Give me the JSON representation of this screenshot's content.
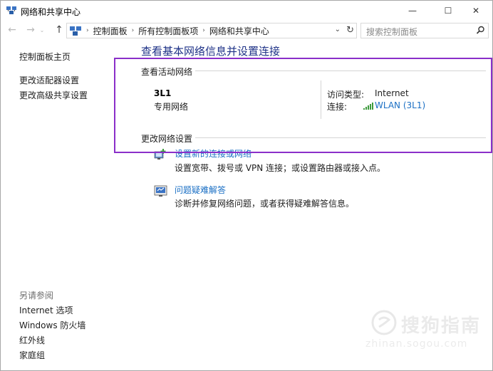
{
  "window": {
    "title": "网络和共享中心",
    "minimize_glyph": "—",
    "maximize_glyph": "☐",
    "close_glyph": "✕"
  },
  "navbar": {
    "back_glyph": "←",
    "forward_glyph": "→",
    "recent_glyph": "⌄",
    "up_glyph": "↑",
    "breadcrumbs": [
      "控制面板",
      "所有控制面板项",
      "网络和共享中心"
    ],
    "breadcrumb_sep": "›",
    "dropdown_glyph": "⌄",
    "refresh_glyph": "↻",
    "search_placeholder": "搜索控制面板"
  },
  "sidebar": {
    "items": [
      {
        "label": "控制面板主页"
      },
      {
        "label": "更改适配器设置"
      },
      {
        "label": "更改高级共享设置"
      }
    ],
    "see_also_heading": "另请参阅",
    "see_also": [
      {
        "label": "Internet 选项"
      },
      {
        "label": "Windows 防火墙"
      },
      {
        "label": "红外线"
      },
      {
        "label": "家庭组"
      }
    ]
  },
  "main": {
    "title": "查看基本网络信息并设置连接",
    "active_section": "查看活动网络",
    "network": {
      "name": "3L1",
      "type": "专用网络",
      "access_label": "访问类型:",
      "access_value": "Internet",
      "connection_label": "连接:",
      "connection_value": "WLAN (3L1)"
    },
    "change_section": "更改网络设置",
    "tasks": [
      {
        "link": "设置新的连接或网络",
        "desc": "设置宽带、拨号或 VPN 连接；或设置路由器或接入点。",
        "icon": "new-connection-icon"
      },
      {
        "link": "问题疑难解答",
        "desc": "诊断并修复网络问题，或者获得疑难解答信息。",
        "icon": "troubleshoot-icon"
      }
    ]
  },
  "watermark": {
    "text": "搜狗指南",
    "sub": "zhinan.sogou.com"
  },
  "colors": {
    "highlight": "#8a2fc9",
    "link": "#1a6fc4",
    "title": "#1e3287",
    "signal": "#3c9a3c"
  }
}
